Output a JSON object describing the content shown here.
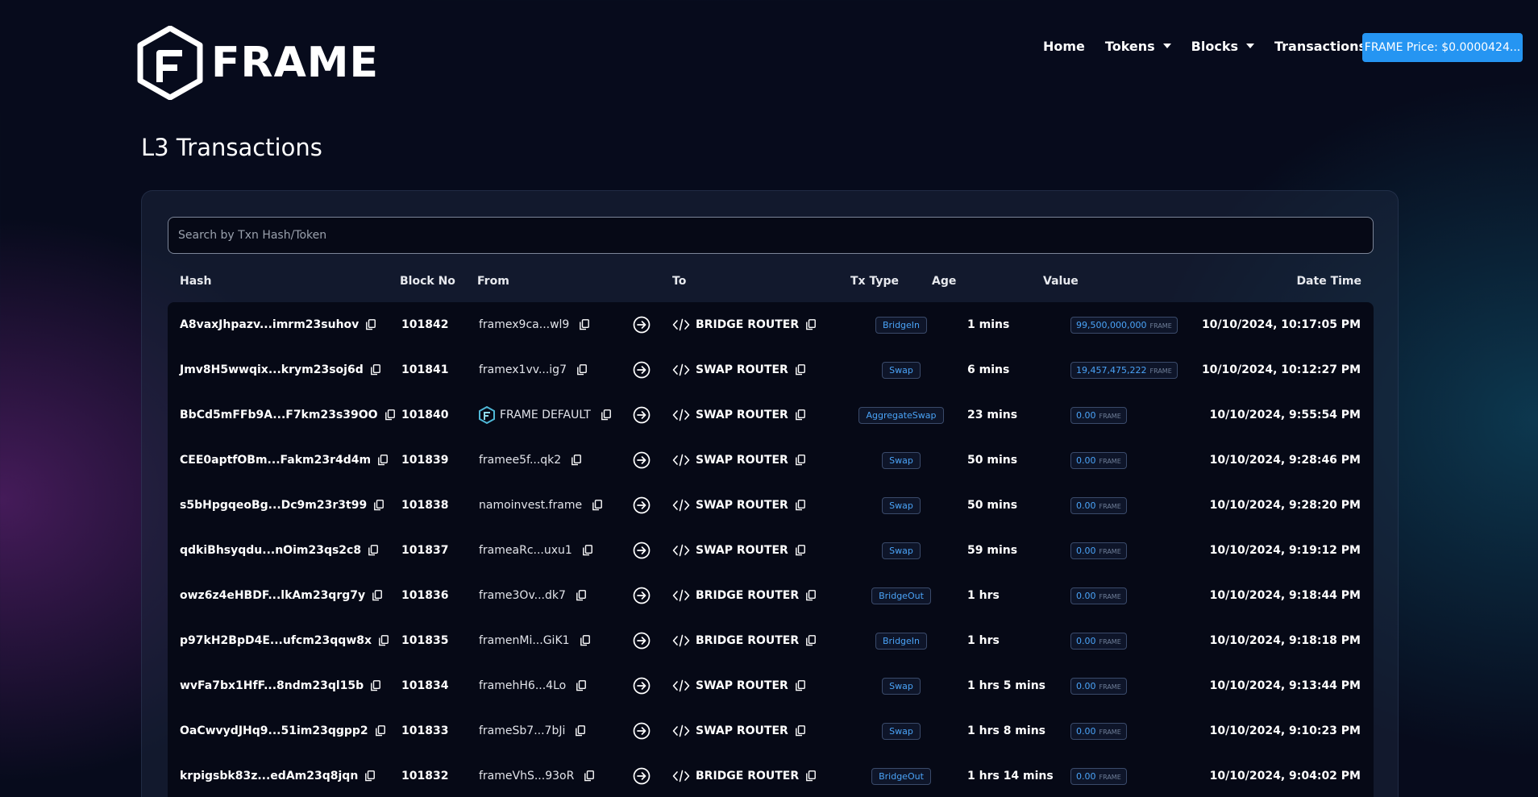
{
  "brand": {
    "name": "FRAME"
  },
  "nav": {
    "items": [
      {
        "label": "Home",
        "dropdown": false
      },
      {
        "label": "Tokens",
        "dropdown": true
      },
      {
        "label": "Blocks",
        "dropdown": true
      },
      {
        "label": "Transactions",
        "dropdown": true
      }
    ],
    "price_button": "FRAME Price: $0.0000424..."
  },
  "page": {
    "title": "L3 Transactions"
  },
  "search": {
    "placeholder": "Search by Txn Hash/Token",
    "value": ""
  },
  "table": {
    "headers": [
      "Hash",
      "Block No",
      "From",
      "To",
      "Tx Type",
      "Age",
      "Value",
      "Date Time"
    ],
    "rows": [
      {
        "hash": "A8vaxJhpazv...imrm23suhov",
        "block": "101842",
        "from": "framex9ca...wl9",
        "from_logo": false,
        "to": "BRIDGE ROUTER",
        "tx_type": "BridgeIn",
        "age": "1 mins",
        "value": "99,500,000,000",
        "unit": "FRAME",
        "datetime": "10/10/2024, 10:17:05 PM"
      },
      {
        "hash": "Jmv8H5wwqix...krym23soj6d",
        "block": "101841",
        "from": "framex1vv...ig7",
        "from_logo": false,
        "to": "SWAP ROUTER",
        "tx_type": "Swap",
        "age": "6 mins",
        "value": "19,457,475,222",
        "unit": "FRAME",
        "datetime": "10/10/2024, 10:12:27 PM"
      },
      {
        "hash": "BbCd5mFFb9A...F7km23s39OO",
        "block": "101840",
        "from": "FRAME DEFAULT",
        "from_logo": true,
        "to": "SWAP ROUTER",
        "tx_type": "AggregateSwap",
        "age": "23 mins",
        "value": "0.00",
        "unit": "FRAME",
        "datetime": "10/10/2024, 9:55:54 PM"
      },
      {
        "hash": "CEE0aptfOBm...Fakm23r4d4m",
        "block": "101839",
        "from": "framee5f...qk2",
        "from_logo": false,
        "to": "SWAP ROUTER",
        "tx_type": "Swap",
        "age": "50 mins",
        "value": "0.00",
        "unit": "FRAME",
        "datetime": "10/10/2024, 9:28:46 PM"
      },
      {
        "hash": "s5bHpgqeoBg...Dc9m23r3t99",
        "block": "101838",
        "from": "namoinvest.frame",
        "from_logo": false,
        "to": "SWAP ROUTER",
        "tx_type": "Swap",
        "age": "50 mins",
        "value": "0.00",
        "unit": "FRAME",
        "datetime": "10/10/2024, 9:28:20 PM"
      },
      {
        "hash": "qdkiBhsyqdu...nOim23qs2c8",
        "block": "101837",
        "from": "frameaRc...uxu1",
        "from_logo": false,
        "to": "SWAP ROUTER",
        "tx_type": "Swap",
        "age": "59 mins",
        "value": "0.00",
        "unit": "FRAME",
        "datetime": "10/10/2024, 9:19:12 PM"
      },
      {
        "hash": "owz6z4eHBDF...lkAm23qrg7y",
        "block": "101836",
        "from": "frame3Ov...dk7",
        "from_logo": false,
        "to": "BRIDGE ROUTER",
        "tx_type": "BridgeOut",
        "age": "1 hrs",
        "value": "0.00",
        "unit": "FRAME",
        "datetime": "10/10/2024, 9:18:44 PM"
      },
      {
        "hash": "p97kH2BpD4E...ufcm23qqw8x",
        "block": "101835",
        "from": "framenMi...GiK1",
        "from_logo": false,
        "to": "BRIDGE ROUTER",
        "tx_type": "BridgeIn",
        "age": "1 hrs",
        "value": "0.00",
        "unit": "FRAME",
        "datetime": "10/10/2024, 9:18:18 PM"
      },
      {
        "hash": "wvFa7bx1HfF...8ndm23ql15b",
        "block": "101834",
        "from": "framehH6...4Lo",
        "from_logo": false,
        "to": "SWAP ROUTER",
        "tx_type": "Swap",
        "age": "1 hrs 5 mins",
        "value": "0.00",
        "unit": "FRAME",
        "datetime": "10/10/2024, 9:13:44 PM"
      },
      {
        "hash": "OaCwvydJHq9...51im23qgpp2",
        "block": "101833",
        "from": "frameSb7...7bJi",
        "from_logo": false,
        "to": "SWAP ROUTER",
        "tx_type": "Swap",
        "age": "1 hrs 8 mins",
        "value": "0.00",
        "unit": "FRAME",
        "datetime": "10/10/2024, 9:10:23 PM"
      },
      {
        "hash": "krpigsbk83z...edAm23q8jqn",
        "block": "101832",
        "from": "frameVhS...93oR",
        "from_logo": false,
        "to": "BRIDGE ROUTER",
        "tx_type": "BridgeOut",
        "age": "1 hrs 14 mins",
        "value": "0.00",
        "unit": "FRAME",
        "datetime": "10/10/2024, 9:04:02 PM"
      }
    ]
  },
  "colors": {
    "accent": "#2595f2",
    "badge_text": "#4aa3f7",
    "background": "#070b1c"
  },
  "icons": {
    "copy": "copy-icon",
    "arrow": "arrow-right-circle-icon",
    "code": "code-icon",
    "caret": "chevron-down-icon",
    "logo": "frame-logo-icon"
  }
}
